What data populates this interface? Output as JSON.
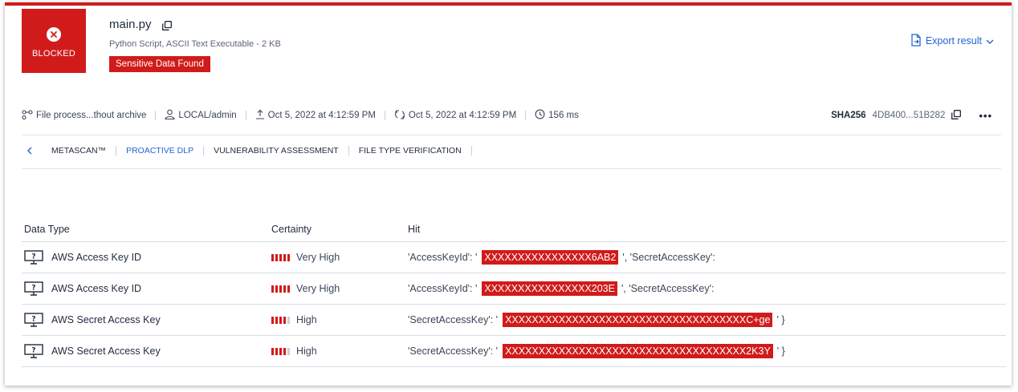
{
  "header": {
    "status_label": "BLOCKED",
    "file_name": "main.py",
    "file_meta": "Python Script, ASCII Text Executable - 2 KB",
    "badge": "Sensitive Data Found",
    "export_label": "Export result"
  },
  "info_bar": {
    "workflow": "File process...thout archive",
    "user": "LOCAL/admin",
    "uploaded": "Oct 5, 2022 at 4:12:59 PM",
    "processed": "Oct 5, 2022 at 4:12:59 PM",
    "duration": "156 ms",
    "sha_label": "SHA256",
    "sha_value": "4DB400...51B282",
    "more": "•••"
  },
  "tabs": [
    {
      "label": "METASCAN™"
    },
    {
      "label": "PROACTIVE DLP",
      "active": true
    },
    {
      "label": "VULNERABILITY ASSESSMENT"
    },
    {
      "label": "FILE TYPE VERIFICATION"
    }
  ],
  "table": {
    "headers": {
      "type": "Data Type",
      "certainty": "Certainty",
      "hit": "Hit"
    },
    "rows": [
      {
        "type": "AWS Access Key ID",
        "certainty": "Very High",
        "certainty_level": 5,
        "hit_prefix": "'AccessKeyId': '",
        "hit_value": "XXXXXXXXXXXXXXXX6AB2",
        "hit_suffix": "', 'SecretAccessKey':"
      },
      {
        "type": "AWS Access Key ID",
        "certainty": "Very High",
        "certainty_level": 5,
        "hit_prefix": "'AccessKeyId': '",
        "hit_value": "XXXXXXXXXXXXXXXX203E",
        "hit_suffix": "', 'SecretAccessKey':"
      },
      {
        "type": "AWS Secret Access Key",
        "certainty": "High",
        "certainty_level": 4,
        "hit_prefix": "'SecretAccessKey': '",
        "hit_value": "XXXXXXXXXXXXXXXXXXXXXXXXXXXXXXXXXXXXC+ge",
        "hit_suffix": "' }"
      },
      {
        "type": "AWS Secret Access Key",
        "certainty": "High",
        "certainty_level": 4,
        "hit_prefix": "'SecretAccessKey': '",
        "hit_value": "XXXXXXXXXXXXXXXXXXXXXXXXXXXXXXXXXXXX2K3Y",
        "hit_suffix": "' }"
      }
    ]
  },
  "colors": {
    "accent_red": "#d11b1b",
    "link_blue": "#2563d6"
  }
}
